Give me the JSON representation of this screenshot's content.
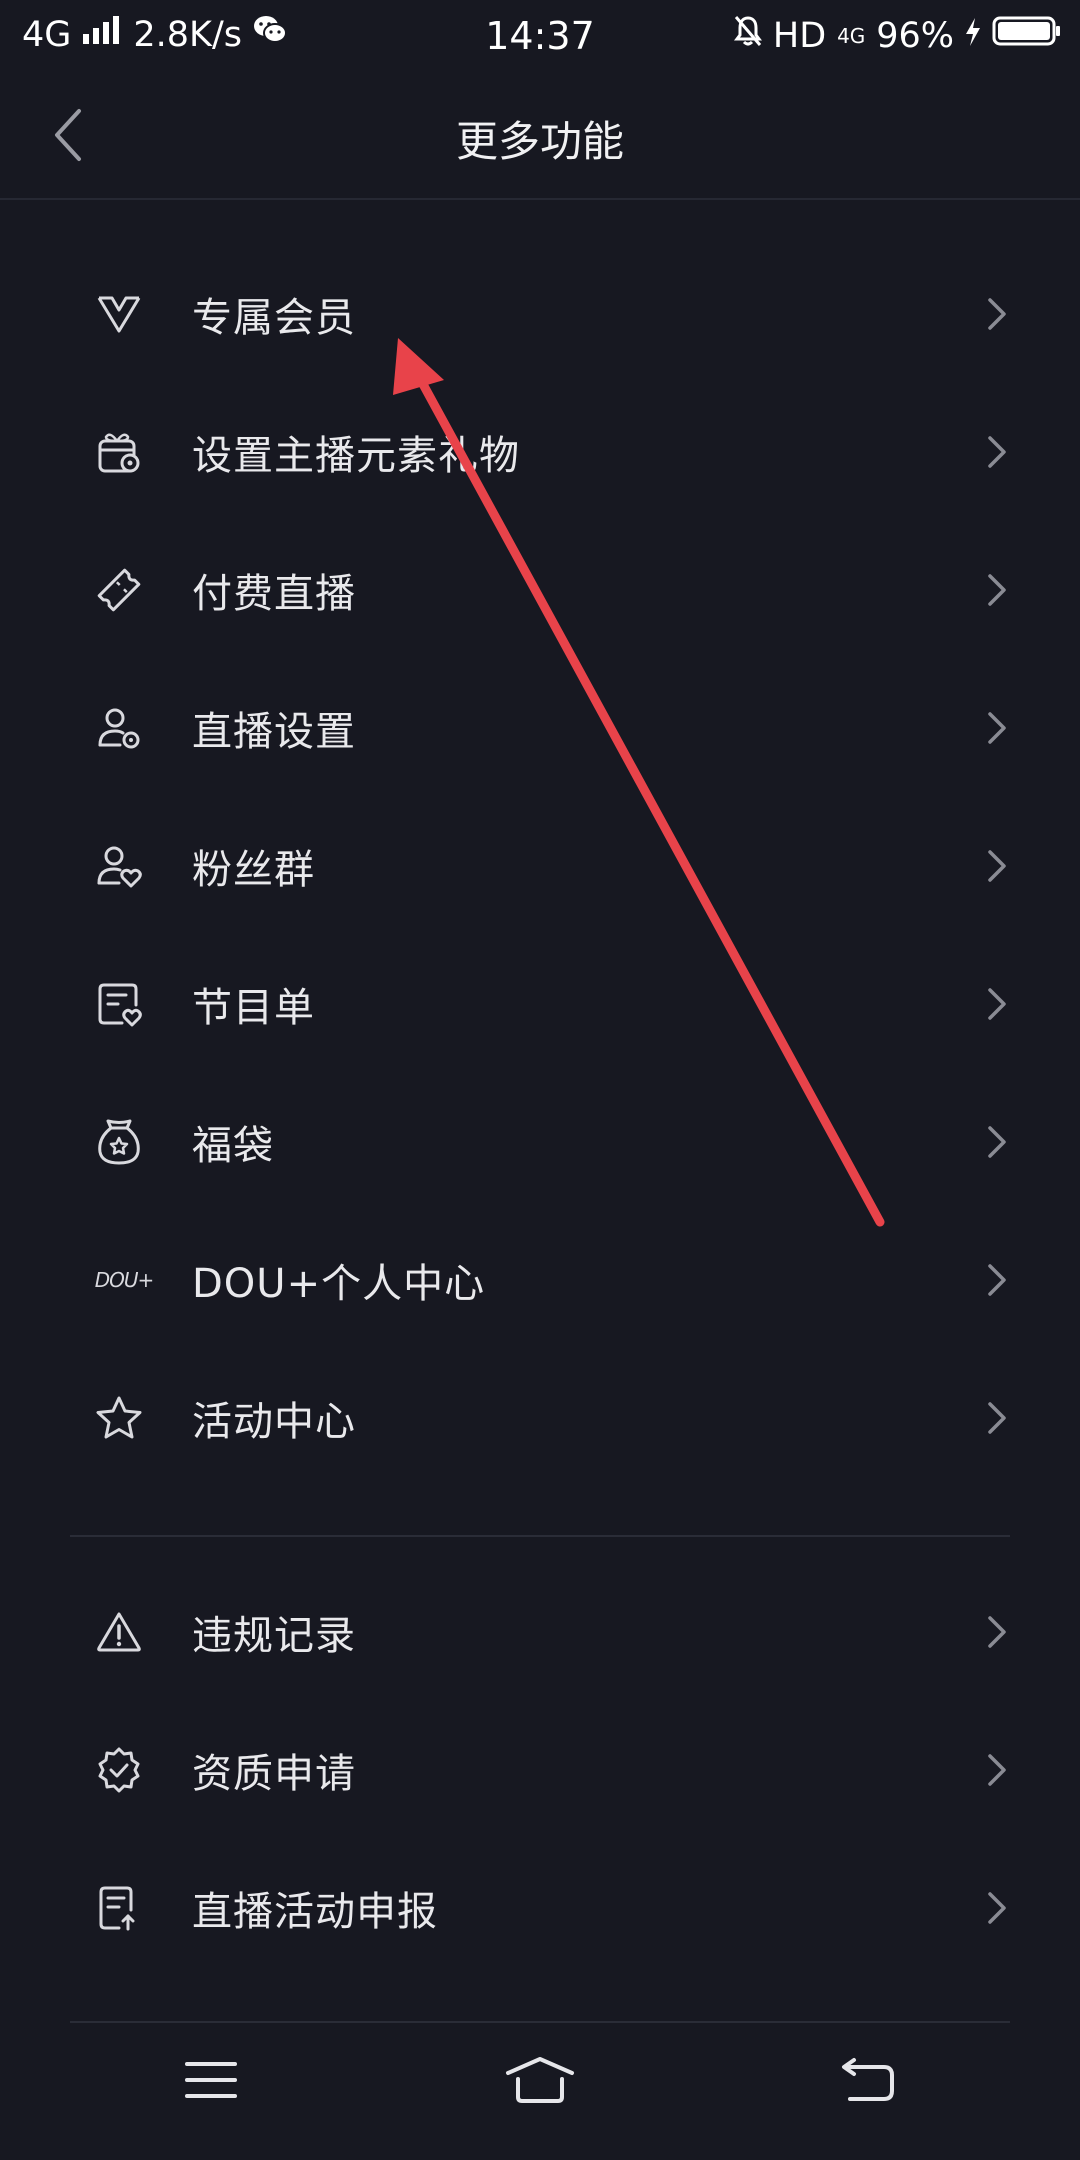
{
  "status_bar": {
    "network": "4G",
    "speed": "2.8K/s",
    "time": "14:37",
    "hd": "HD",
    "net_small": "4G",
    "battery": "96%"
  },
  "header": {
    "title": "更多功能"
  },
  "section1": [
    {
      "label": "专属会员",
      "icon": "v-member-icon"
    },
    {
      "label": "设置主播元素礼物",
      "icon": "gift-settings-icon"
    },
    {
      "label": "付费直播",
      "icon": "ticket-icon"
    },
    {
      "label": "直播设置",
      "icon": "user-settings-icon"
    },
    {
      "label": "粉丝群",
      "icon": "fan-group-icon"
    },
    {
      "label": "节目单",
      "icon": "program-list-icon"
    },
    {
      "label": "福袋",
      "icon": "lucky-bag-icon"
    },
    {
      "label": "DOU+个人中心",
      "icon": "dou-plus-icon",
      "icon_text": "DOU+"
    },
    {
      "label": "活动中心",
      "icon": "star-icon"
    }
  ],
  "section2": [
    {
      "label": "违规记录",
      "icon": "warning-icon"
    },
    {
      "label": "资质申请",
      "icon": "badge-check-icon"
    },
    {
      "label": "直播活动申报",
      "icon": "report-doc-icon"
    }
  ],
  "colors": {
    "background": "#171821",
    "text": "#e9e9ec",
    "chevron": "#8a8b94",
    "annotation": "#e8434a"
  }
}
